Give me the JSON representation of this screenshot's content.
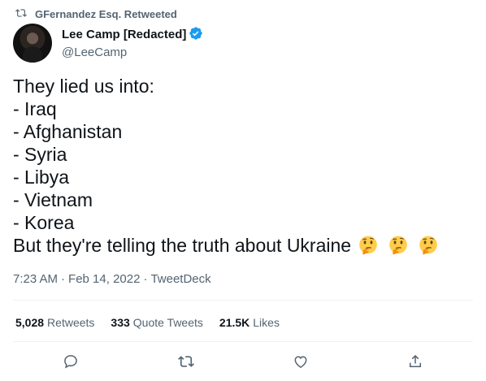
{
  "retweet_context": {
    "text": "GFernandez Esq. Retweeted",
    "icon": "retweet-icon"
  },
  "author": {
    "display_name": "Lee Camp [Redacted]",
    "handle": "@LeeCamp",
    "verified": true,
    "avatar_icon": "avatar"
  },
  "tweet": {
    "lines": [
      "They lied us into:",
      "- Iraq",
      "- Afghanistan",
      "- Syria",
      "- Libya",
      "- Vietnam",
      "- Korea",
      "But they're telling the truth about Ukraine"
    ],
    "trailing_emojis": [
      "thinking-face",
      "thinking-face",
      "thinking-face"
    ]
  },
  "meta": {
    "time": "7:23 AM",
    "date": "Feb 14, 2022",
    "source": "TweetDeck",
    "separator": "·"
  },
  "stats": {
    "retweets_count": "5,028",
    "retweets_label": "Retweets",
    "quotes_count": "333",
    "quotes_label": "Quote Tweets",
    "likes_count": "21.5K",
    "likes_label": "Likes"
  },
  "colors": {
    "text_primary": "#0f1419",
    "text_secondary": "#536471",
    "verified_blue": "#1d9bf0",
    "divider": "#eff3f4"
  },
  "actions": [
    "reply-icon",
    "retweet-icon",
    "like-icon",
    "share-icon"
  ]
}
